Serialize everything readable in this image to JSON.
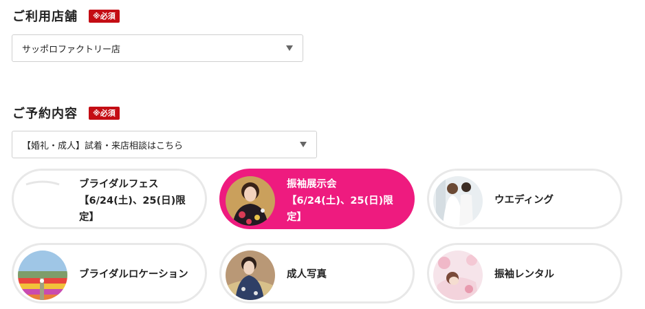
{
  "store_section": {
    "title": "ご利用店舗",
    "required_badge": "※必須",
    "selected_value": "サッポロファクトリー店"
  },
  "reservation_section": {
    "title": "ご予約内容",
    "required_badge": "※必須",
    "selected_value": "【婚礼・成人】試着・来店相談はこちら"
  },
  "cards": [
    {
      "title": "ブライダルフェス",
      "subtitle": "【6/24(土)、25(日)限",
      "subtitle2": "定】"
    },
    {
      "title": "振袖展示会",
      "subtitle": "【6/24(土)、25(日)限",
      "subtitle2": "定】"
    },
    {
      "title": "ウエディング"
    },
    {
      "title": "ブライダルロケーション"
    },
    {
      "title": "成人写真"
    },
    {
      "title": "振袖レンタル"
    }
  ],
  "colors": {
    "required_badge": "#c40d14",
    "active_card": "#ee1b7f",
    "card_border": "#e8e8e8"
  }
}
